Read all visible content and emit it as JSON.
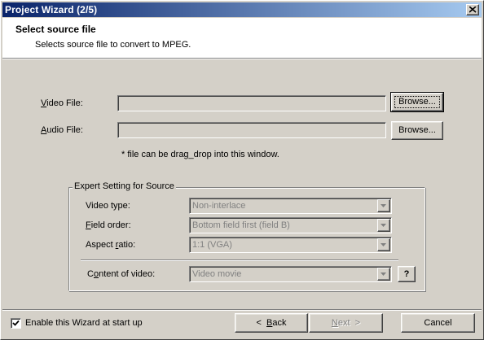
{
  "window": {
    "title": "Project Wizard (2/5)",
    "close_glyph": "close-icon"
  },
  "header": {
    "title": "Select source file",
    "subtitle": "Selects source file to convert to MPEG."
  },
  "files": {
    "video_label_key": "V",
    "video_label_rest": "ideo File:",
    "video_value": "",
    "audio_label_key": "A",
    "audio_label_rest": "udio File:",
    "audio_value": "",
    "browse_label": "Browse...",
    "hint": "* file can be drag_drop into this window."
  },
  "expert": {
    "group_title": "Expert Setting for Source",
    "video_type_label": "Video type:",
    "video_type_value": "Non-interlace",
    "field_order_key": "F",
    "field_order_rest": "ield order:",
    "field_order_value": "Bottom field first (field B)",
    "aspect_ratio_pre": "Aspect ",
    "aspect_ratio_key": "r",
    "aspect_ratio_post": "atio:",
    "aspect_ratio_value": "1:1 (VGA)",
    "content_pre": "C",
    "content_key": "o",
    "content_post": "ntent of video:",
    "content_value": "Video movie",
    "help_label": "?"
  },
  "footer": {
    "checkbox_label": "Enable this Wizard at start up",
    "checkbox_checked": true,
    "back_key": "B",
    "back_rest": "ack",
    "back_arrow": "<",
    "next_key": "N",
    "next_rest": "ext",
    "next_arrow": ">",
    "cancel_label": "Cancel"
  },
  "colors": {
    "face": "#d4d0c8",
    "title_start": "#0a246a",
    "title_end": "#a6caf0",
    "disabled_text": "#808080"
  }
}
